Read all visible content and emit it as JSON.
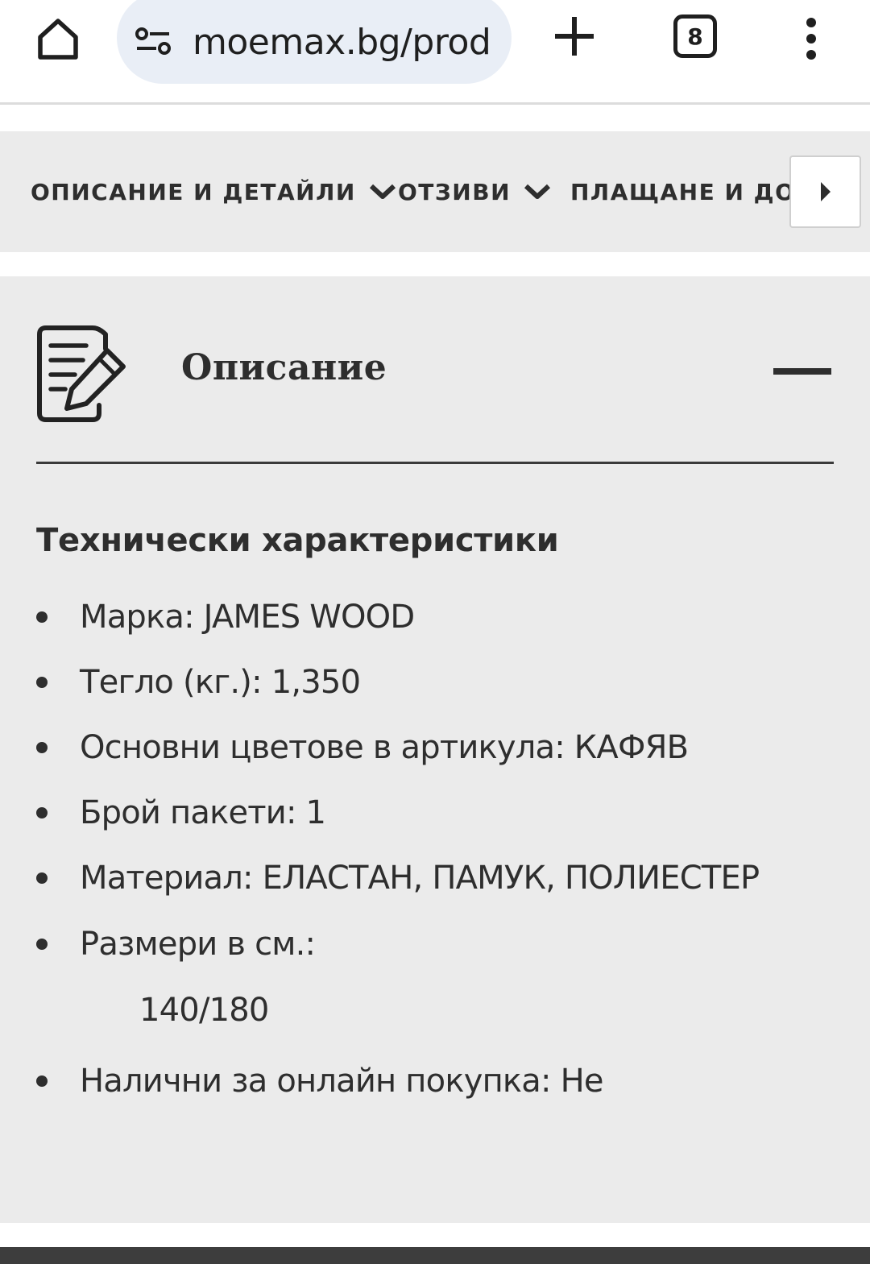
{
  "browser": {
    "url": "moemax.bg/prod",
    "tab_count": "8",
    "icons": [
      "home-icon",
      "site-settings-icon",
      "plus-icon",
      "tab-switcher-icon",
      "more-vert-icon"
    ]
  },
  "tabs": [
    {
      "label": "ОПИСАНИЕ И ДЕТАЙЛИ"
    },
    {
      "label": "ОТЗИВИ"
    },
    {
      "label": "ПЛАЩАНЕ И ДОС"
    }
  ],
  "panel": {
    "title": "Описание",
    "spec_heading": "Технически характеристики",
    "specs": [
      {
        "text": "Марка: JAMES WOOD"
      },
      {
        "text": "Тегло (кг.): 1,350"
      },
      {
        "text": "Основни цветове в артикула: КАФЯВ"
      },
      {
        "text": "Брой пакети: 1"
      },
      {
        "text": "Материал: ЕЛАСТАН, ПАМУК, ПОЛИЕСТЕР"
      },
      {
        "text": "Размери в см.:",
        "sub": "140/180"
      },
      {
        "text": "Налични за онлайн покупка: Не"
      }
    ]
  },
  "colors": {
    "panel_bg": "#ebebeb",
    "text": "#2e2e2e",
    "url_pill": "#e9eef6",
    "footer": "#3d3d3d"
  }
}
